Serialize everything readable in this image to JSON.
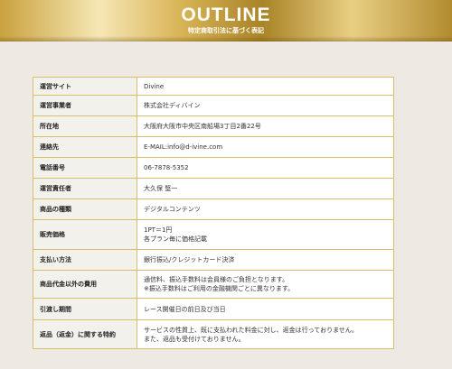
{
  "header": {
    "title": "OUTLINE",
    "subtitle": "特定商取引法に基づく表記"
  },
  "rows": [
    {
      "label": "運営サイト",
      "lines": [
        "Divine"
      ]
    },
    {
      "label": "運営事業者",
      "lines": [
        "株式会社ディバイン"
      ]
    },
    {
      "label": "所在地",
      "lines": [
        "大阪府大阪市中央区南船場3丁目2番22号"
      ]
    },
    {
      "label": "連絡先",
      "lines": [
        "E-MAIL:info@d-ivine.com"
      ]
    },
    {
      "label": "電話番号",
      "lines": [
        "06-7878-5352"
      ]
    },
    {
      "label": "運営責任者",
      "lines": [
        "大久保 堅一"
      ]
    },
    {
      "label": "商品の種類",
      "lines": [
        "デジタルコンテンツ"
      ]
    },
    {
      "label": "販売価格",
      "lines": [
        "1PT＝1円",
        "各プラン毎に価格記載"
      ]
    },
    {
      "label": "支払い方法",
      "lines": [
        "銀行振込/クレジットカード決済"
      ]
    },
    {
      "label": "商品代金以外の費用",
      "lines": [
        "通信料、振込手数料は会員様のご負担となります。",
        "※振込手数料はご利用の金融機関ごとに異なります。"
      ]
    },
    {
      "label": "引渡し期間",
      "lines": [
        "レース開催日の前日及び当日"
      ]
    },
    {
      "label": "返品（返金）に関する特約",
      "lines": [
        "サービスの性質上、既に支払われた料金に対し、返金は行っておりません。",
        "また、返品も受付けておりません。"
      ]
    }
  ]
}
